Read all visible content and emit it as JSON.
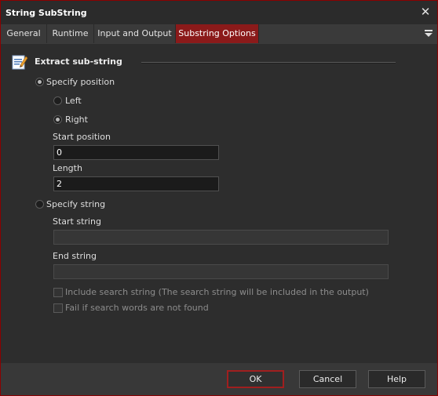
{
  "window": {
    "title": "String SubString",
    "close_icon": "close-icon"
  },
  "tabs": [
    {
      "label": "General"
    },
    {
      "label": "Runtime"
    },
    {
      "label": "Input and Output"
    },
    {
      "label": "Substring Options",
      "active": true
    }
  ],
  "section": {
    "title": "Extract sub-string",
    "icon": "edit-document-icon"
  },
  "mode": {
    "specify_position_label": "Specify position",
    "specify_position_selected": true,
    "specify_string_label": "Specify string",
    "specify_string_selected": false
  },
  "direction": {
    "left_label": "Left",
    "left_selected": false,
    "right_label": "Right",
    "right_selected": true
  },
  "fields": {
    "start_position_label": "Start position",
    "start_position_value": "0",
    "length_label": "Length",
    "length_value": "2",
    "start_string_label": "Start string",
    "start_string_value": "",
    "end_string_label": "End string",
    "end_string_value": ""
  },
  "options": {
    "include_search_label": "Include search string (The search string will be included in the output)",
    "include_search_checked": false,
    "fail_if_not_found_label": "Fail if search words are not found",
    "fail_if_not_found_checked": false
  },
  "buttons": {
    "ok": "OK",
    "cancel": "Cancel",
    "help": "Help"
  },
  "colors": {
    "accent": "#8b1a1a",
    "background": "#2d2d2d",
    "footer": "#383838"
  }
}
